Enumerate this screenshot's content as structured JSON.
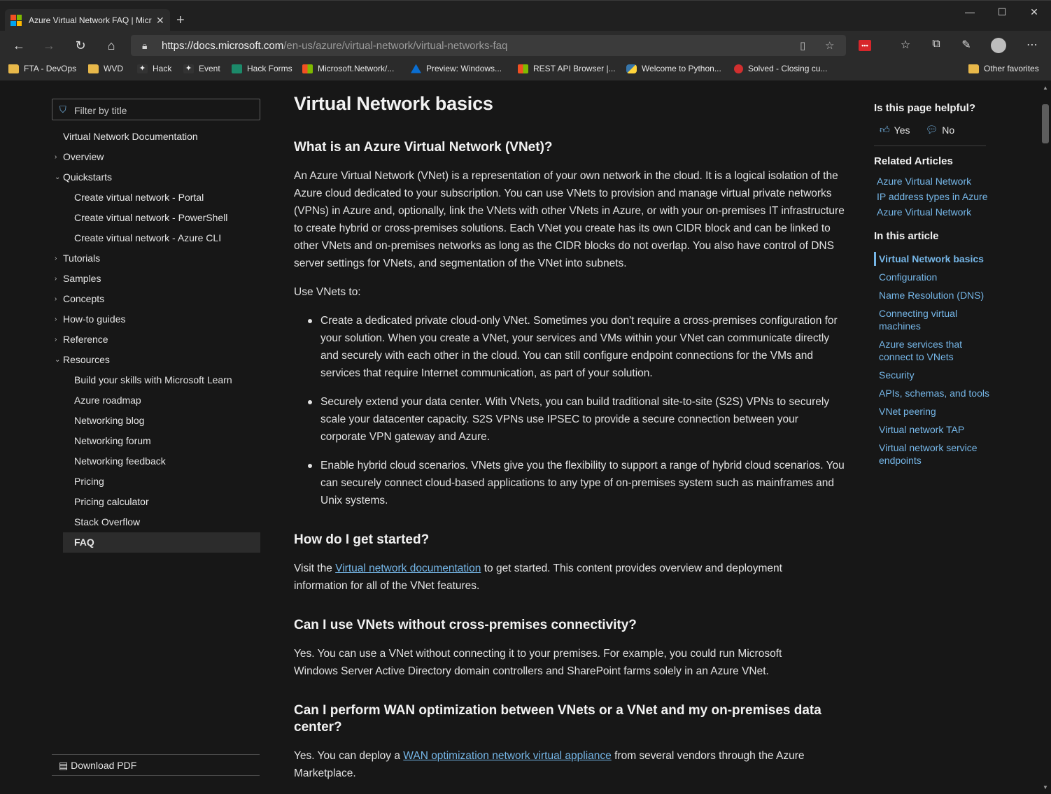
{
  "browser": {
    "tab_title": "Azure Virtual Network FAQ | Microsoft Docs",
    "url_host": "https://docs.microsoft.com",
    "url_path": "/en-us/azure/virtual-network/virtual-networks-faq",
    "favorites": [
      {
        "label": "FTA - DevOps",
        "icon": "folder-icon"
      },
      {
        "label": "WVD",
        "icon": "folder-icon"
      },
      {
        "label": "Hack",
        "icon": "hack-icon"
      },
      {
        "label": "Event",
        "icon": "event-icon"
      },
      {
        "label": "Hack Forms",
        "icon": "forms-icon"
      },
      {
        "label": "Microsoft.Network/...",
        "icon": "microsoft-icon"
      },
      {
        "label": "Preview: Windows...",
        "icon": "azure-icon"
      },
      {
        "label": "REST API Browser |...",
        "icon": "microsoft-icon"
      },
      {
        "label": "Welcome to Python...",
        "icon": "python-icon"
      },
      {
        "label": "Solved - Closing cu...",
        "icon": "solved-icon"
      }
    ],
    "other_favorites": "Other favorites",
    "ext_badge": "•••"
  },
  "leftnav": {
    "filter_placeholder": "Filter by title",
    "items": [
      {
        "label": "Virtual Network Documentation",
        "level": 0,
        "chevron": ""
      },
      {
        "label": "Overview",
        "level": 0,
        "chevron": "›"
      },
      {
        "label": "Quickstarts",
        "level": 0,
        "chevron": "⌄"
      },
      {
        "label": "Create virtual network - Portal",
        "level": 1,
        "chevron": ""
      },
      {
        "label": "Create virtual network - PowerShell",
        "level": 1,
        "chevron": ""
      },
      {
        "label": "Create virtual network - Azure CLI",
        "level": 1,
        "chevron": ""
      },
      {
        "label": "Tutorials",
        "level": 0,
        "chevron": "›"
      },
      {
        "label": "Samples",
        "level": 0,
        "chevron": "›"
      },
      {
        "label": "Concepts",
        "level": 0,
        "chevron": "›"
      },
      {
        "label": "How-to guides",
        "level": 0,
        "chevron": "›"
      },
      {
        "label": "Reference",
        "level": 0,
        "chevron": "›"
      },
      {
        "label": "Resources",
        "level": 0,
        "chevron": "⌄"
      },
      {
        "label": "Build your skills with Microsoft Learn",
        "level": 1,
        "chevron": ""
      },
      {
        "label": "Azure roadmap",
        "level": 1,
        "chevron": ""
      },
      {
        "label": "Networking blog",
        "level": 1,
        "chevron": ""
      },
      {
        "label": "Networking forum",
        "level": 1,
        "chevron": ""
      },
      {
        "label": "Networking feedback",
        "level": 1,
        "chevron": ""
      },
      {
        "label": "Pricing",
        "level": 1,
        "chevron": ""
      },
      {
        "label": "Pricing calculator",
        "level": 1,
        "chevron": ""
      },
      {
        "label": "Stack Overflow",
        "level": 1,
        "chevron": ""
      },
      {
        "label": "FAQ",
        "level": 1,
        "chevron": "",
        "active": true
      }
    ],
    "download_pdf": "Download PDF"
  },
  "main": {
    "h1": "Virtual Network basics",
    "q1": "What is an Azure Virtual Network (VNet)?",
    "p1": "An Azure Virtual Network (VNet) is a representation of your own network in the cloud. It is a logical isolation of the Azure cloud dedicated to your subscription. You can use VNets to provision and manage virtual private networks (VPNs) in Azure and, optionally, link the VNets with other VNets in Azure, or with your on-premises IT infrastructure to create hybrid or cross-premises solutions. Each VNet you create has its own CIDR block and can be linked to other VNets and on-premises networks as long as the CIDR blocks do not overlap. You also have control of DNS server settings for VNets, and segmentation of the VNet into subnets.",
    "p2": "Use VNets to:",
    "bullets": [
      "Create a dedicated private cloud-only VNet. Sometimes you don't require a cross-premises configuration for your solution. When you create a VNet, your services and VMs within your VNet can communicate directly and securely with each other in the cloud. You can still configure endpoint connections for the VMs and services that require Internet communication, as part of your solution.",
      "Securely extend your data center. With VNets, you can build traditional site-to-site (S2S) VPNs to securely scale your datacenter capacity. S2S VPNs use IPSEC to provide a secure connection between your corporate VPN gateway and Azure.",
      "Enable hybrid cloud scenarios. VNets give you the flexibility to support a range of hybrid cloud scenarios. You can securely connect cloud-based applications to any type of on-premises system such as mainframes and Unix systems."
    ],
    "q2": "How do I get started?",
    "p3_before": "Visit the ",
    "p3_link": "Virtual network documentation",
    "p3_after": " to get started. This content provides overview and deployment information for all of the VNet features.",
    "q3": "Can I use VNets without cross-premises connectivity?",
    "p4": "Yes. You can use a VNet without connecting it to your premises. For example, you could run Microsoft Windows Server Active Directory domain controllers and SharePoint farms solely in an Azure VNet.",
    "q4": "Can I perform WAN optimization between VNets or a VNet and my on-premises data center?",
    "p5_before": "Yes. You can deploy a ",
    "p5_link": "WAN optimization network virtual appliance",
    "p5_after": " from several vendors through the Azure Marketplace."
  },
  "rail": {
    "helpful_title": "Is this page helpful?",
    "yes": "Yes",
    "no": "No",
    "related_title": "Related Articles",
    "related": [
      "Azure Virtual Network",
      "IP address types in Azure",
      "Azure Virtual Network"
    ],
    "in_article_title": "In this article",
    "in_article": [
      "Virtual Network basics",
      "Configuration",
      "Name Resolution (DNS)",
      "Connecting virtual machines",
      "Azure services that connect to VNets",
      "Security",
      "APIs, schemas, and tools",
      "VNet peering",
      "Virtual network TAP",
      "Virtual network service endpoints"
    ]
  }
}
